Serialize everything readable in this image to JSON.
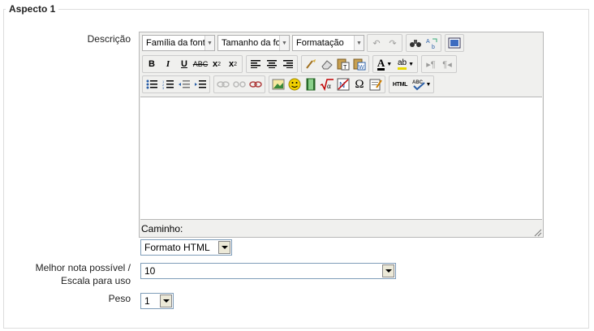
{
  "fieldset": {
    "legend": "Aspecto 1"
  },
  "description": {
    "label": "Descrição",
    "toolbar": {
      "font_family": "Família da font",
      "font_size": "Tamanho da fo",
      "format": "Formatação"
    },
    "status_path": "Caminho:"
  },
  "format_select": {
    "value": "Formato HTML"
  },
  "grade": {
    "label_line1": "Melhor nota possível /",
    "label_line2": "Escala para uso",
    "value": "10"
  },
  "weight": {
    "label": "Peso",
    "value": "1"
  }
}
